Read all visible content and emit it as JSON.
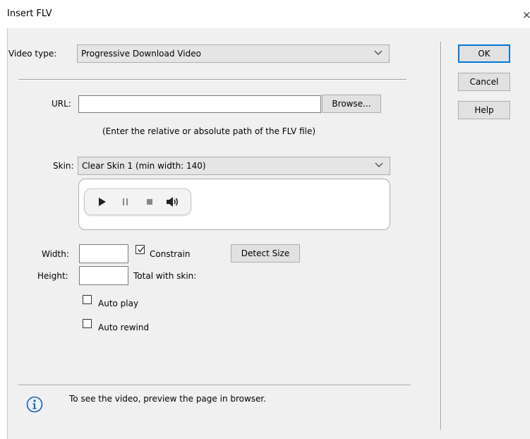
{
  "window": {
    "title": "Insert FLV",
    "close_glyph": "×"
  },
  "video_type": {
    "label": "Video type:",
    "value": "Progressive Download Video"
  },
  "url": {
    "label": "URL:",
    "value": "",
    "browse_label": "Browse...",
    "hint": "(Enter the relative or absolute path of the FLV file)"
  },
  "skin": {
    "label": "Skin:",
    "value": "Clear Skin 1 (min width: 140)",
    "preview_icons": [
      "play-icon",
      "pause-icon",
      "stop-icon",
      "volume-icon"
    ]
  },
  "size": {
    "width_label": "Width:",
    "width_value": "",
    "height_label": "Height:",
    "height_value": "",
    "constrain_label": "Constrain",
    "constrain_checked": true,
    "detect_size_label": "Detect Size",
    "total_with_skin_label": "Total with skin:"
  },
  "options": {
    "auto_play_label": "Auto play",
    "auto_play_checked": false,
    "auto_rewind_label": "Auto rewind",
    "auto_rewind_checked": false
  },
  "info": {
    "icon": "info-icon",
    "text": "To see the video, preview the page in browser."
  },
  "buttons": {
    "ok": "OK",
    "cancel": "Cancel",
    "help": "Help"
  },
  "colors": {
    "dialog_bg": "#f0f0f0",
    "default_button_border": "#0078d7",
    "info_icon_blue": "#1f5fa8"
  }
}
